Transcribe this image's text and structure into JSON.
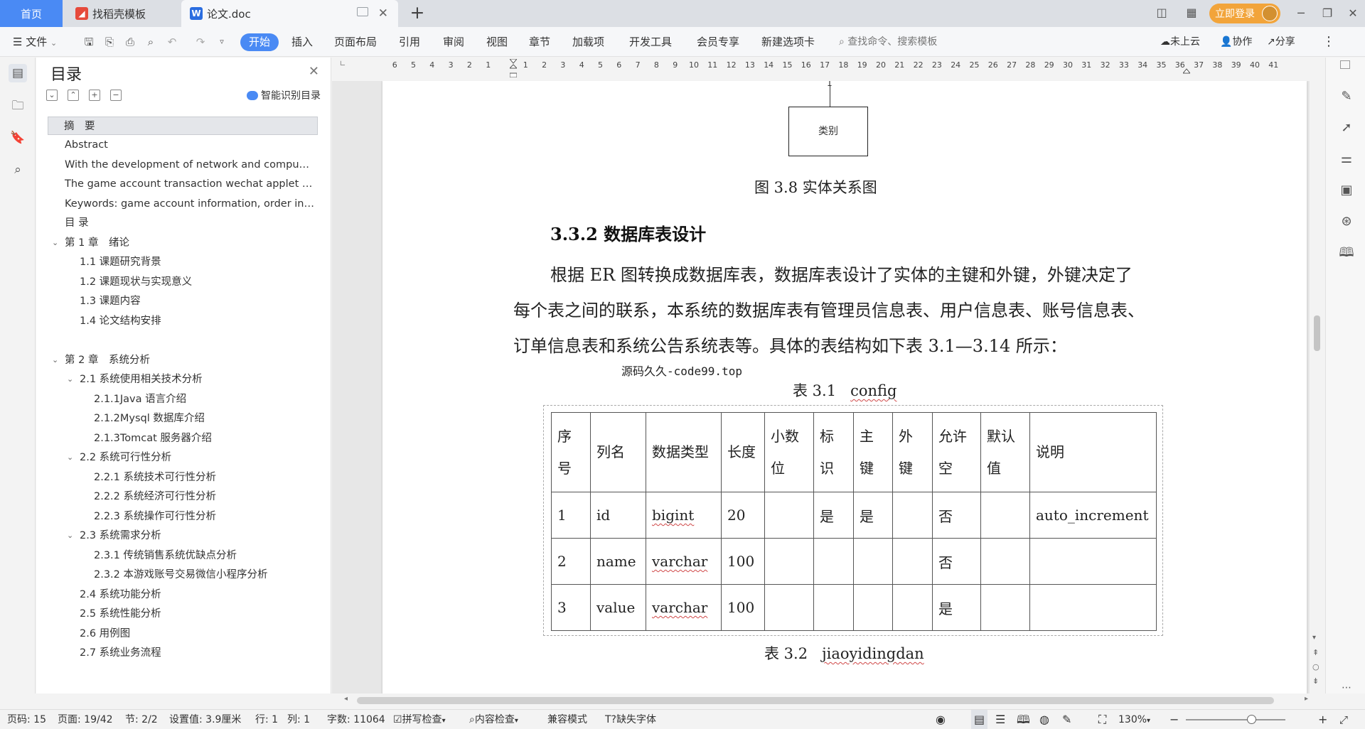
{
  "tabbar": {
    "home": "首页",
    "template": "找稻壳模板",
    "doc": "论文.doc",
    "login": "立即登录"
  },
  "menu": {
    "file": "文件",
    "items": [
      "开始",
      "插入",
      "页面布局",
      "引用",
      "审阅",
      "视图",
      "章节",
      "加载项",
      "开发工具",
      "会员专享",
      "新建选项卡"
    ],
    "search_placeholder": "查找命令、搜索模板",
    "cloud": "未上云",
    "collab": "协作",
    "share": "分享"
  },
  "toc": {
    "title": "目录",
    "smart": "智能识别目录",
    "items": [
      "摘　要",
      "Abstract",
      "With the development of network and compu…",
      "The game account transaction wechat applet …",
      "Keywords: game account information, order in…",
      "目 录",
      "第 1 章　绪论",
      "1.1 课题研究背景",
      "1.2 课题现状与实现意义",
      "1.3 课题内容",
      "1.4 论文结构安排",
      "第 2 章　系统分析",
      "2.1 系统使用相关技术分析",
      "2.1.1Java 语言介绍",
      "2.1.2Mysql 数据库介绍",
      "2.1.3Tomcat 服务器介绍",
      "2.2 系统可行性分析",
      "2.2.1 系统技术可行性分析",
      "2.2.2 系统经济可行性分析",
      "2.2.3 系统操作可行性分析",
      "2.3 系统需求分析",
      "2.3.1 传统销售系统优缺点分析",
      "2.3.2 本游戏账号交易微信小程序分析",
      "2.4 系统功能分析",
      "2.5 系统性能分析",
      "2.6 用例图",
      "2.7 系统业务流程"
    ]
  },
  "ruler": {
    "left_ticks": [
      "6",
      "5",
      "4",
      "3",
      "2",
      "1"
    ],
    "right_ticks": [
      "1",
      "2",
      "3",
      "4",
      "5",
      "6",
      "7",
      "8",
      "9",
      "10",
      "11",
      "12",
      "13",
      "14",
      "15",
      "16",
      "17",
      "18",
      "19",
      "20",
      "21",
      "22",
      "23",
      "24",
      "25",
      "26",
      "27",
      "28",
      "29",
      "30",
      "31",
      "32",
      "33",
      "34",
      "35",
      "36",
      "37",
      "38",
      "39",
      "40",
      "41"
    ]
  },
  "doc": {
    "er_top_label": "1",
    "er_box": "类别",
    "fig_caption": "图 3.8 实体关系图",
    "heading": "3.3.2 数据库表设计",
    "para1": "根据 ER 图转换成数据库表，数据库表设计了实体的主键和外键，外键决定了",
    "para2": "每个表之间的联系，本系统的数据库表有管理员信息表、用户信息表、账号信息表、",
    "para3": "订单信息表和系统公告系统表等。具体的表结构如下表 3.1—3.14 所示：",
    "watermark": "源码久久-code99.top",
    "table1_prefix": "表 3.1",
    "table1_name": "config",
    "table2_prefix": "表 3.2",
    "table2_name": "jiaoyidingdan",
    "table_headers": [
      "序号",
      "列名",
      "数据类型",
      "长度",
      "小数位",
      "标识",
      "主键",
      "外键",
      "允许空",
      "默认值",
      "说明"
    ],
    "table_rows": [
      [
        "1",
        "id",
        "bigint",
        "20",
        "",
        "是",
        "是",
        "",
        "否",
        "",
        "auto_increment"
      ],
      [
        "2",
        "name",
        "varchar",
        "100",
        "",
        "",
        "",
        "",
        "否",
        "",
        ""
      ],
      [
        "3",
        "value",
        "varchar",
        "100",
        "",
        "",
        "",
        "",
        "是",
        "",
        ""
      ]
    ]
  },
  "status": {
    "page_code": "页码: 15",
    "page": "页面: 19/42",
    "section": "节: 2/2",
    "setting": "设置值: 3.9厘米",
    "row": "行: 1",
    "col": "列: 1",
    "words": "字数: 11064",
    "spell": "拼写检查",
    "content": "内容检查",
    "compat": "兼容模式",
    "missing_font": "缺失字体",
    "zoom": "130%"
  },
  "colors": {
    "accent": "#4a8af4",
    "login": "#f2a43a"
  }
}
